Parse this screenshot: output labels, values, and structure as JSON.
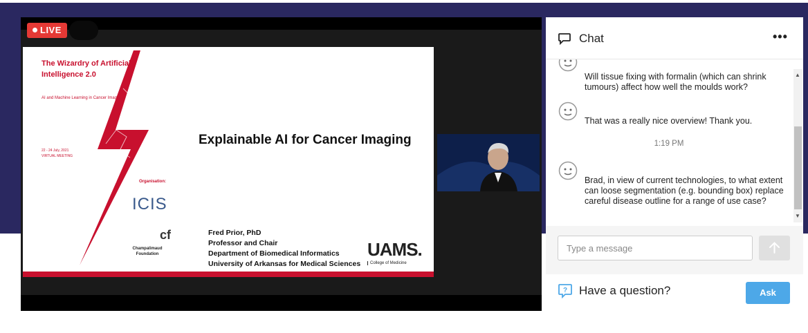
{
  "stream": {
    "live_label": "LIVE",
    "slide": {
      "event_title": "The Wizardry of Artificial Intelligence 2.0",
      "event_subtitle": "AI and Machine Learning in Cancer Imaging",
      "event_dates": "22 - 24 July, 2021",
      "event_mode": "VIRTUAL MEETING",
      "organisation_label": "Organisation:",
      "org_logo_1": "ICIS",
      "org_logo_2_name": "Champalimaud Foundation",
      "talk_title": "Explainable AI for Cancer Imaging",
      "speaker_lines": [
        "Fred Prior, PhD",
        "Professor and Chair",
        "Department of Biomedical Informatics",
        "University of Arkansas for Medical Sciences"
      ],
      "institution_logo": "UAMS.",
      "institution_sub": "College of Medicine"
    }
  },
  "chat": {
    "title": "Chat",
    "more_icon": "ellipsis-icon",
    "messages": [
      {
        "text": "Will tissue fixing with formalin (which can shrink tumours) affect how well the moulds work?"
      },
      {
        "text": "That was a really nice overview! Thank you."
      },
      {
        "text": "Brad, in view of current technologies, to what extent can loose segmentation (e.g. bounding box) replace careful disease outline for a range of use case?"
      }
    ],
    "timestamp": "1:19 PM",
    "input_placeholder": "Type a message",
    "send_icon": "arrow-up-icon"
  },
  "question": {
    "label": "Have a question?",
    "ask_label": "Ask",
    "accent_color": "#4da8e8"
  },
  "colors": {
    "header_bg": "#2a2860",
    "live_red": "#e53935",
    "slide_red": "#c8102e"
  }
}
